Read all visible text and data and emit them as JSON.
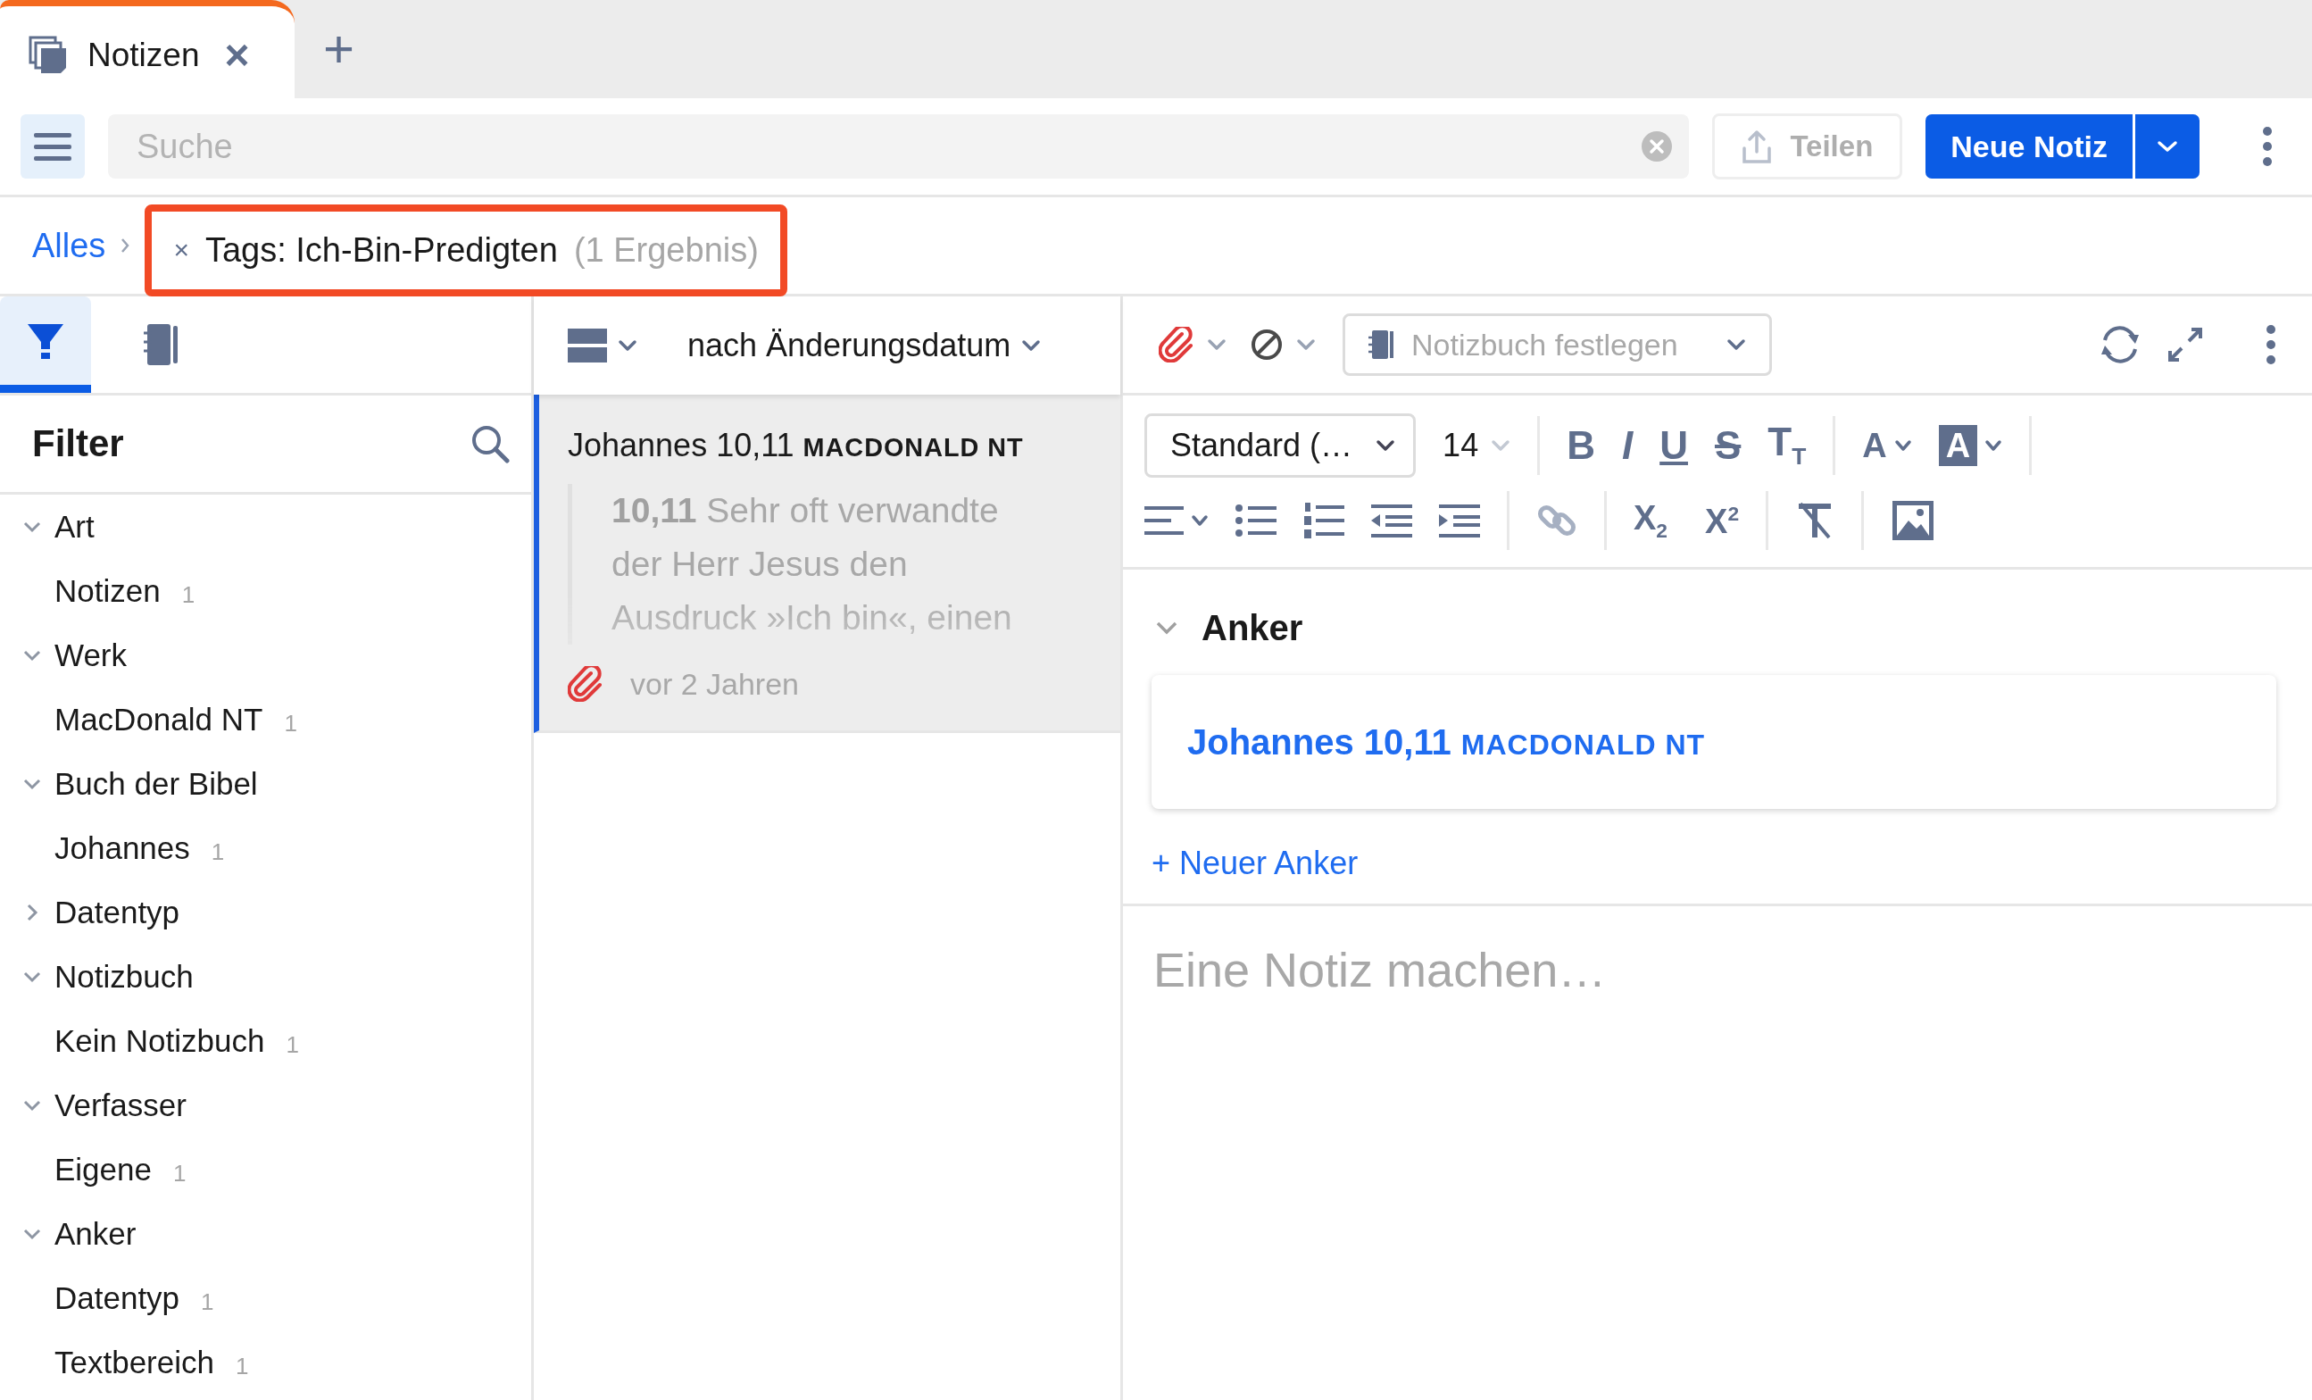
{
  "tab": {
    "title": "Notizen",
    "close": "×",
    "selected": true
  },
  "new_tab": "+",
  "toolbar": {
    "search": {
      "placeholder": "Suche"
    },
    "share_button": "Teilen",
    "new_note_button": "Neue Notiz"
  },
  "breadcrumb": {
    "root": "Alles",
    "filter_remove": "×",
    "filter": "Tags: Ich-Bin-Predigten",
    "result_count": "(1 Ergebnis)",
    "highlighted": true
  },
  "sidebar": {
    "tabs": [
      {
        "kind": "filter",
        "selected": true
      },
      {
        "kind": "notebook",
        "selected": false
      }
    ],
    "title": "Filter",
    "tree": [
      {
        "label": "Art",
        "expanded": true,
        "children": [
          {
            "label": "Notizen",
            "count": "1"
          }
        ]
      },
      {
        "label": "Werk",
        "expanded": true,
        "children": [
          {
            "label": "MacDonald NT",
            "count": "1"
          }
        ]
      },
      {
        "label": "Buch der Bibel",
        "expanded": true,
        "children": [
          {
            "label": "Johannes",
            "count": "1"
          }
        ]
      },
      {
        "label": "Datentyp",
        "expanded": false
      },
      {
        "label": "Notizbuch",
        "expanded": true,
        "children": [
          {
            "label": "Kein Notizbuch",
            "count": "1"
          }
        ]
      },
      {
        "label": "Verfasser",
        "expanded": true,
        "children": [
          {
            "label": "Eigene",
            "count": "1"
          }
        ]
      },
      {
        "label": "Anker",
        "expanded": true,
        "children": [
          {
            "label": "Datentyp",
            "count": "1"
          },
          {
            "label": "Textbereich",
            "count": "1"
          }
        ]
      }
    ]
  },
  "list": {
    "sort": "nach Änderungsdatum",
    "notes": [
      {
        "title": "Johannes 10,11",
        "work": "MACDONALD NT",
        "excerpt": "**10,11** Sehr oft verwandte der Herr Jesus den Ausdruck »Ich bin«, einen",
        "time": "vor 2 Jahren",
        "selected": true
      }
    ]
  },
  "editor": {
    "notebook_placeholder": "Notizbuch festlegen",
    "font": "Standard (…",
    "size": "14",
    "format_tools": [
      {
        "kind": "bold",
        "glyph": "B"
      },
      {
        "kind": "italic",
        "glyph": "I"
      },
      {
        "kind": "underline",
        "glyph": "U"
      },
      {
        "kind": "strike",
        "glyph": "S"
      },
      {
        "kind": "case",
        "glyph": "T$_{T}$"
      },
      {
        "kind": "color",
        "glyph": "A"
      },
      {
        "kind": "highlight",
        "glyph": "A"
      }
    ],
    "script_tools": [
      {
        "kind": "sub",
        "glyph": "X$_{2}$"
      },
      {
        "kind": "sup",
        "glyph": "X$^{2}$"
      }
    ],
    "anchors_title": "Anker",
    "anchors_expanded": true,
    "anchors": [
      {
        "reference": "Johannes 10,11",
        "work": "MACDONALD NT"
      }
    ],
    "add_anchor": "+ Neuer Anker",
    "body_placeholder": "Eine Notiz machen…"
  }
}
